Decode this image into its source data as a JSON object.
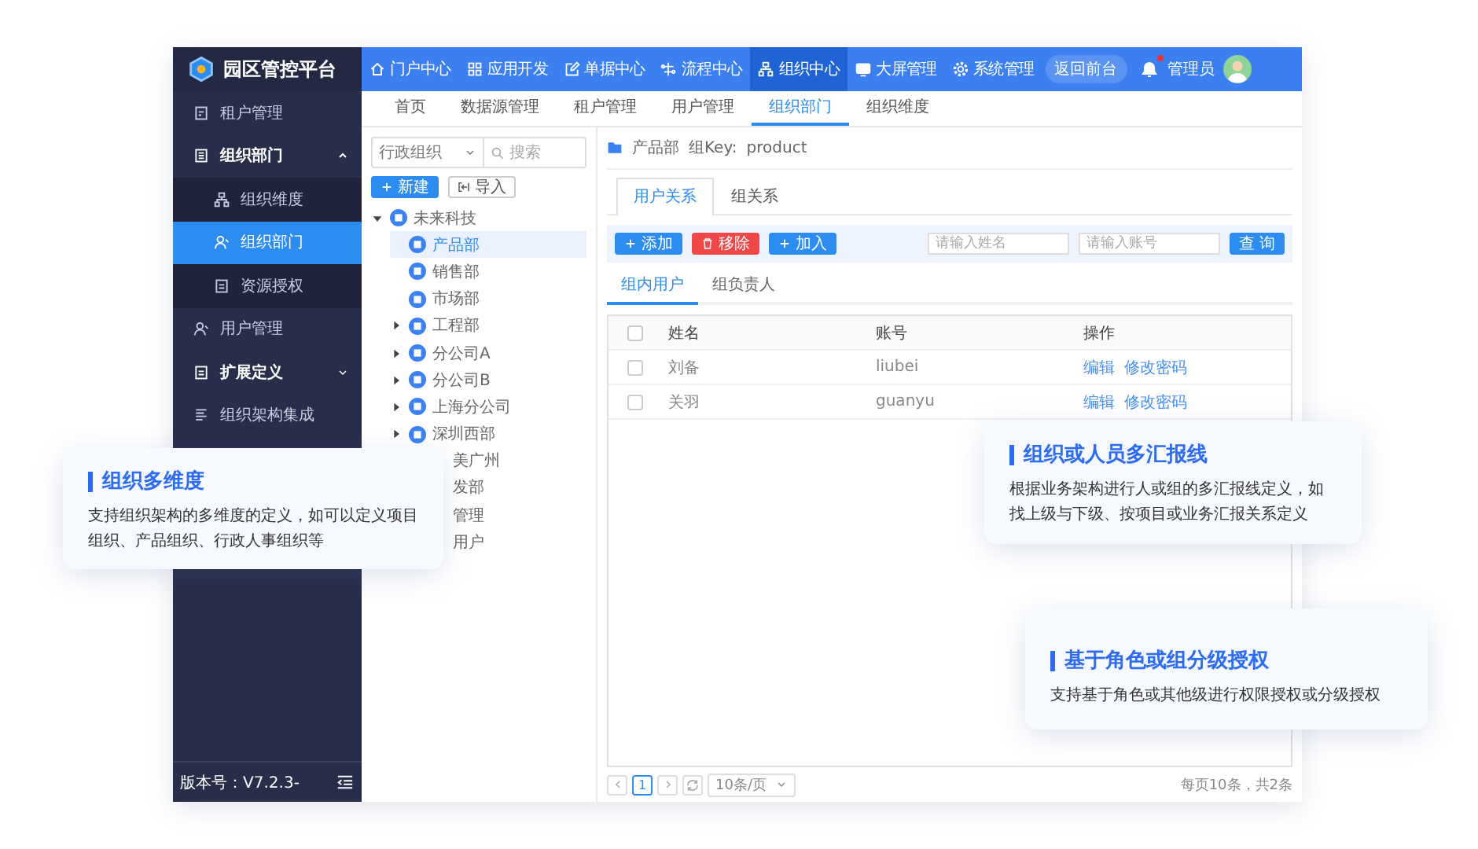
{
  "app": {
    "logo_title": "园区管控平台",
    "version": "版本号：V7.2.3-"
  },
  "sidebar": {
    "items": [
      {
        "label": "租户管理",
        "kind": "item",
        "selected": false
      },
      {
        "label": "组织部门",
        "kind": "group",
        "expanded": true,
        "selected": false,
        "children": [
          {
            "label": "组织维度",
            "selected": false
          },
          {
            "label": "组织部门",
            "selected": true
          },
          {
            "label": "资源授权",
            "selected": false
          }
        ]
      },
      {
        "label": "用户管理",
        "kind": "item",
        "selected": false
      },
      {
        "label": "扩展定义",
        "kind": "group",
        "expanded": false,
        "selected": false
      },
      {
        "label": "组织架构集成",
        "kind": "item",
        "selected": false
      }
    ]
  },
  "top_nav": {
    "items": [
      {
        "label": "门户中心",
        "selected": false
      },
      {
        "label": "应用开发",
        "selected": false
      },
      {
        "label": "单据中心",
        "selected": false
      },
      {
        "label": "流程中心",
        "selected": false
      },
      {
        "label": "组织中心",
        "selected": true
      },
      {
        "label": "大屏管理",
        "selected": false
      },
      {
        "label": "系统管理",
        "selected": false
      }
    ],
    "return_button": "返回前台",
    "notifications_unread": true,
    "user": "管理员"
  },
  "page_tabs": [
    {
      "label": "首页",
      "selected": false
    },
    {
      "label": "数据源管理",
      "selected": false
    },
    {
      "label": "租户管理",
      "selected": false
    },
    {
      "label": "用户管理",
      "selected": false
    },
    {
      "label": "组织部门",
      "selected": true
    },
    {
      "label": "组织维度",
      "selected": false
    }
  ],
  "tree_panel": {
    "scope_select": "行政组织",
    "search_placeholder": "搜索",
    "buttons": [
      {
        "label": "新建",
        "kind": "primary"
      },
      {
        "label": "导入",
        "kind": "default"
      }
    ],
    "tree": [
      {
        "label": "未来科技",
        "kind": "branch",
        "expanded": true,
        "selected": false,
        "children": [
          {
            "label": "产品部",
            "kind": "leaf",
            "selected": true
          },
          {
            "label": "销售部",
            "kind": "leaf",
            "selected": false
          },
          {
            "label": "市场部",
            "kind": "leaf",
            "selected": false
          },
          {
            "label": "工程部",
            "kind": "branch",
            "expanded": false,
            "selected": false
          },
          {
            "label": "分公司A",
            "kind": "branch",
            "expanded": false,
            "selected": false
          },
          {
            "label": "分公司B",
            "kind": "branch",
            "expanded": false,
            "selected": false
          },
          {
            "label": "上海分公司",
            "kind": "branch",
            "expanded": false,
            "selected": false
          },
          {
            "label": "深圳西部",
            "kind": "branch",
            "expanded": false,
            "selected": false
          },
          {
            "label": "美广州",
            "kind": "clipped"
          },
          {
            "label": "发部",
            "kind": "clipped"
          },
          {
            "label": "管理",
            "kind": "clipped"
          },
          {
            "label": "用户",
            "kind": "clipped"
          }
        ]
      }
    ]
  },
  "detail": {
    "header": {
      "name": "产品部",
      "key_label": "组Key:",
      "key_value": "product"
    },
    "tabs": [
      {
        "label": "用户关系",
        "selected": true
      },
      {
        "label": "组关系",
        "selected": false
      }
    ],
    "toolbar": [
      {
        "label": "添加",
        "kind": "primary"
      },
      {
        "label": "移除",
        "kind": "danger"
      },
      {
        "label": "加入",
        "kind": "primary"
      }
    ],
    "filters": [
      {
        "placeholder": "请输入姓名"
      },
      {
        "placeholder": "请输入账号"
      }
    ],
    "search_button": "查 询",
    "sub_tabs": [
      {
        "label": "组内用户",
        "selected": true
      },
      {
        "label": "组负责人",
        "selected": false
      }
    ],
    "table": {
      "header_checked": false,
      "columns": [
        "姓名",
        "账号",
        "操作"
      ],
      "rows": [
        {
          "checked": false,
          "cells": [
            "刘备",
            "liubei"
          ],
          "actions": [
            "编辑",
            "修改密码"
          ]
        },
        {
          "checked": false,
          "cells": [
            "关羽",
            "guanyu"
          ],
          "actions": [
            "编辑",
            "修改密码"
          ]
        }
      ]
    },
    "pagination": {
      "page": "1",
      "page_size": "10条/页",
      "summary": "每页10条，共2条"
    }
  },
  "callouts": [
    {
      "title": "组织多维度",
      "text": "支持组织架构的多维度的定义，如可以定义项目组织、产品组织、行政人事组织等"
    },
    {
      "title": "组织或人员多汇报线",
      "text": "根据业务架构进行人或组的多汇报线定义，如找上级与下级、按项目或业务汇报关系定义"
    },
    {
      "title": "基于角色或组分级授权",
      "text": "支持基于角色或其他级进行权限授权或分级授权"
    }
  ]
}
